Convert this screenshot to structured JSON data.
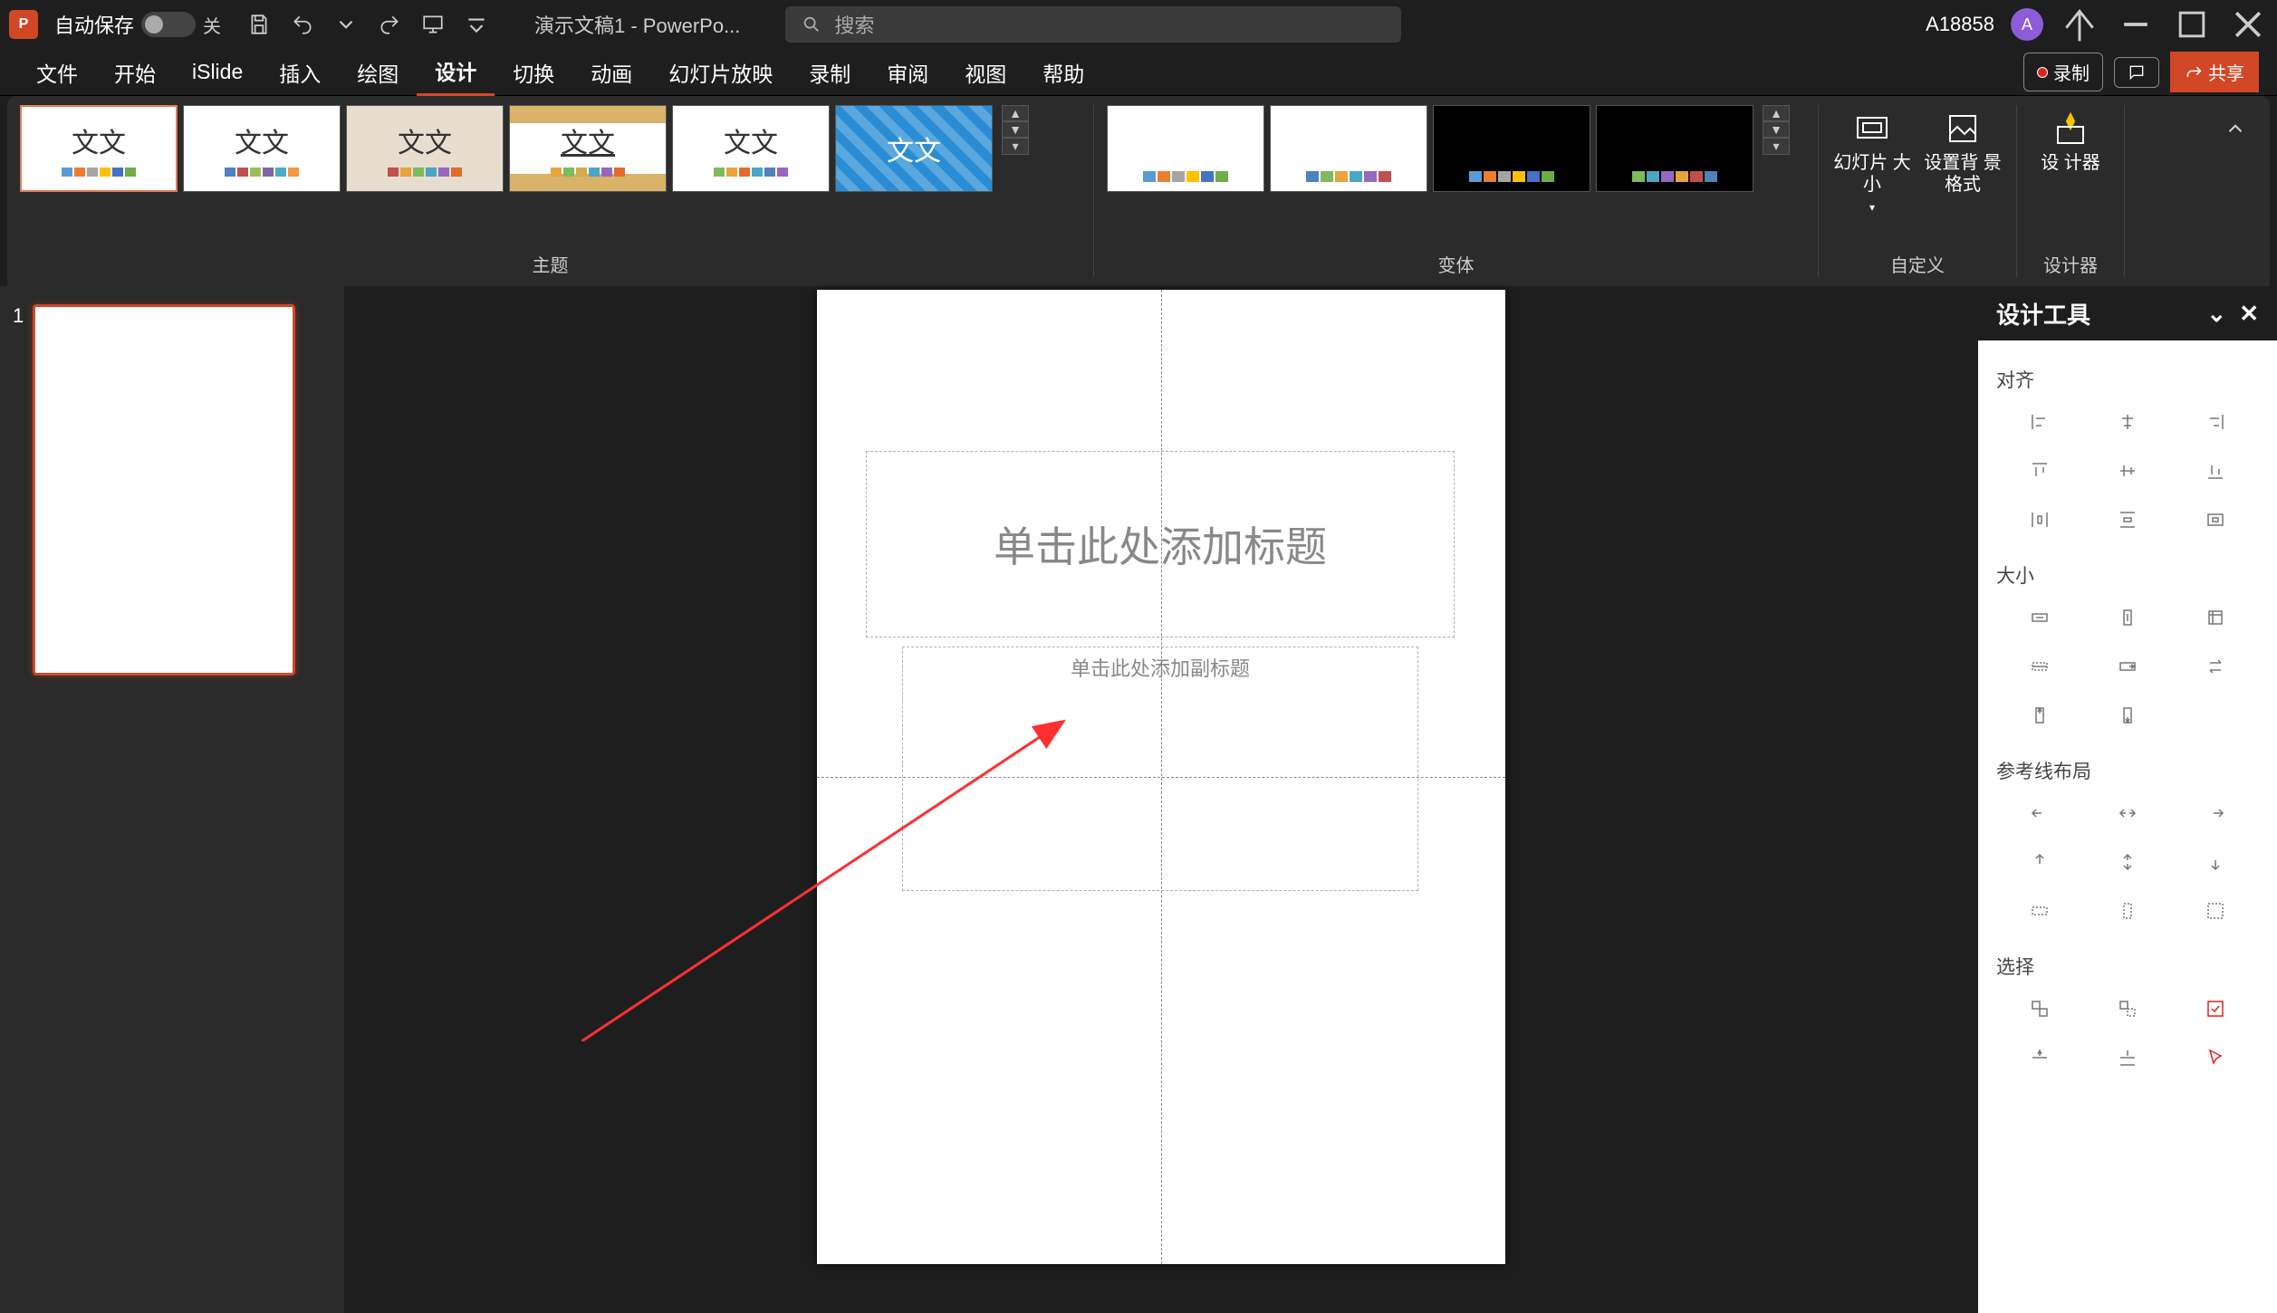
{
  "titlebar": {
    "autosave_label": "自动保存",
    "autosave_state": "关",
    "doc_title": "演示文稿1  - PowerPo...",
    "search_placeholder": "搜索",
    "user": "A18858",
    "avatar_letter": "A"
  },
  "tabs": [
    "文件",
    "开始",
    "iSlide",
    "插入",
    "绘图",
    "设计",
    "切换",
    "动画",
    "幻灯片放映",
    "录制",
    "审阅",
    "视图",
    "帮助"
  ],
  "active_tab_index": 5,
  "tabstrip_right": {
    "record": "录制",
    "share": "共享"
  },
  "ribbon": {
    "themes_label": "主题",
    "variants_label": "变体",
    "customize_label": "自定义",
    "designer_group_label": "设计器",
    "theme_thumb_text": "文文",
    "slide_size": "幻灯片\n大小",
    "bg_format": "设置背\n景格式",
    "designer": "设\n计器"
  },
  "slide_panel": {
    "slide_number": "1"
  },
  "canvas": {
    "title_placeholder": "单击此处添加标题",
    "subtitle_placeholder": "单击此处添加副标题"
  },
  "right_panel": {
    "header": "设计工具",
    "sections": {
      "align": "对齐",
      "size": "大小",
      "guides": "参考线布局",
      "select": "选择"
    }
  }
}
